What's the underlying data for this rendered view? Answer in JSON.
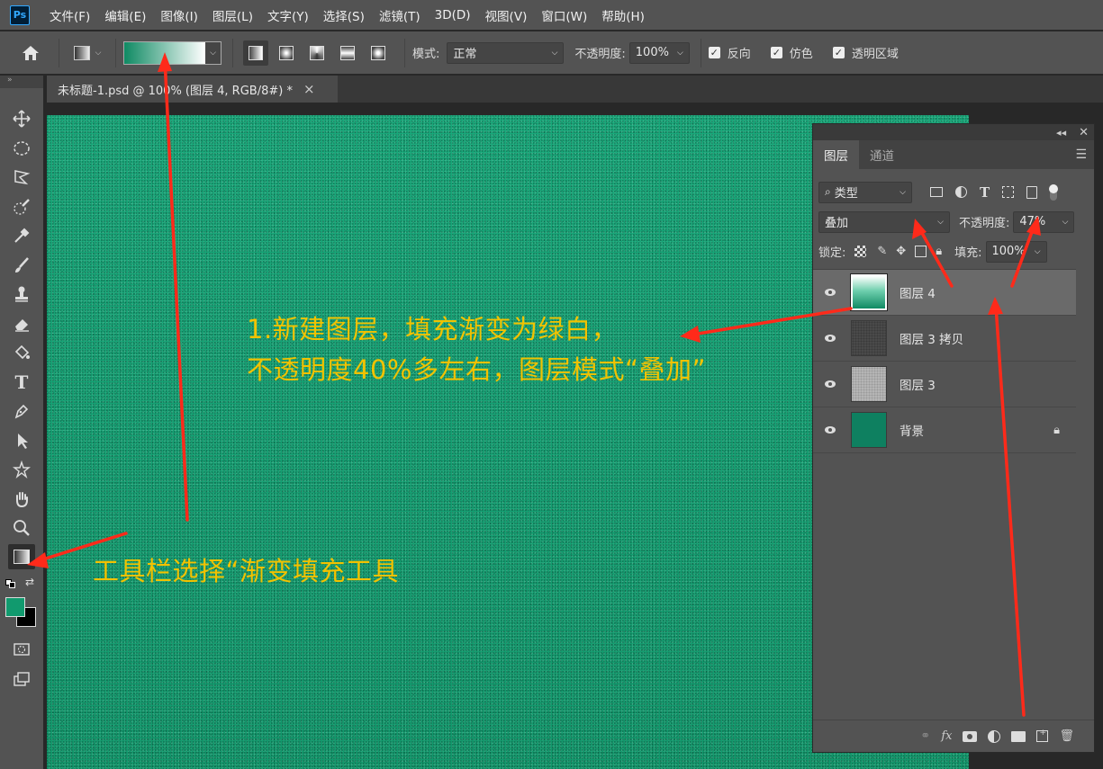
{
  "app": {
    "logo": "Ps"
  },
  "menu": [
    "文件(F)",
    "编辑(E)",
    "图像(I)",
    "图层(L)",
    "文字(Y)",
    "选择(S)",
    "滤镜(T)",
    "3D(D)",
    "视图(V)",
    "窗口(W)",
    "帮助(H)"
  ],
  "options": {
    "mode_label": "模式:",
    "mode_value": "正常",
    "opacity_label": "不透明度:",
    "opacity_value": "100%",
    "reverse_label": "反向",
    "dither_label": "仿色",
    "transparency_label": "透明区域",
    "gradient_colors": [
      "#0f8a63",
      "#ffffff"
    ]
  },
  "document_tab": {
    "title": "未标题-1.psd @ 100% (图层 4, RGB/8#) *",
    "close": "×"
  },
  "colors": {
    "foreground": "#119a6e",
    "background": "#000000",
    "canvas": "#17a677",
    "annotation": "#f2c200",
    "arrow": "#ff2a1a"
  },
  "layers_panel": {
    "tabs": [
      "图层",
      "通道"
    ],
    "filter_value": "类型",
    "blend_mode": "叠加",
    "opacity_label": "不透明度:",
    "opacity_value": "47%",
    "lock_label": "锁定:",
    "fill_label": "填充:",
    "fill_value": "100%",
    "layers": [
      {
        "name": "图层 4",
        "selected": true
      },
      {
        "name": "图层 3 拷贝",
        "selected": false
      },
      {
        "name": "图层 3",
        "selected": false
      },
      {
        "name": "背景",
        "selected": false,
        "locked": true
      }
    ]
  },
  "annotations": {
    "step1_line1": "1.新建图层，填充渐变为绿白，",
    "step1_line2": "不透明度40%多左右，图层模式“叠加”",
    "toolbar_note": "工具栏选择“渐变填充工具"
  }
}
